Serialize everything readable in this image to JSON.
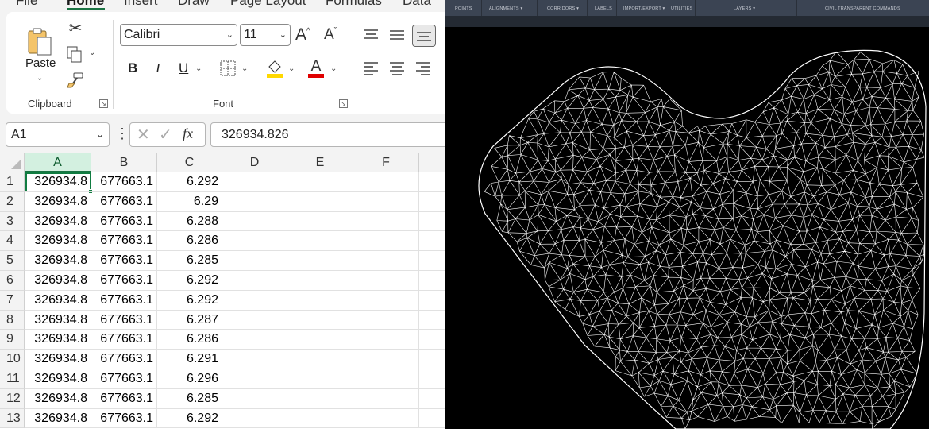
{
  "excel": {
    "tabs": [
      "File",
      "Home",
      "Insert",
      "Draw",
      "Page Layout",
      "Formulas",
      "Data"
    ],
    "active_tab": "Home",
    "clipboard": {
      "paste_label": "Paste",
      "group_label": "Clipboard"
    },
    "font": {
      "family": "Calibri",
      "size": "11",
      "group_label": "Font",
      "fill_color": "#ffd800",
      "font_color": "#e00000",
      "bold_label": "B",
      "italic_label": "I",
      "underline_label": "U",
      "grow_label": "A",
      "shrink_label": "A",
      "fontcolor_letter": "A"
    },
    "name_box": "A1",
    "fx_label": "fx",
    "formula_value": "326934.826",
    "columns": [
      "A",
      "B",
      "C",
      "D",
      "E",
      "F"
    ],
    "rows": [
      {
        "n": "1",
        "a": "326934.8",
        "b": "677663.1",
        "c": "6.292"
      },
      {
        "n": "2",
        "a": "326934.8",
        "b": "677663.1",
        "c": "6.29"
      },
      {
        "n": "3",
        "a": "326934.8",
        "b": "677663.1",
        "c": "6.288"
      },
      {
        "n": "4",
        "a": "326934.8",
        "b": "677663.1",
        "c": "6.286"
      },
      {
        "n": "5",
        "a": "326934.8",
        "b": "677663.1",
        "c": "6.285"
      },
      {
        "n": "6",
        "a": "326934.8",
        "b": "677663.1",
        "c": "6.292"
      },
      {
        "n": "7",
        "a": "326934.8",
        "b": "677663.1",
        "c": "6.292"
      },
      {
        "n": "8",
        "a": "326934.8",
        "b": "677663.1",
        "c": "6.287"
      },
      {
        "n": "9",
        "a": "326934.8",
        "b": "677663.1",
        "c": "6.286"
      },
      {
        "n": "10",
        "a": "326934.8",
        "b": "677663.1",
        "c": "6.291"
      },
      {
        "n": "11",
        "a": "326934.8",
        "b": "677663.1",
        "c": "6.296"
      },
      {
        "n": "12",
        "a": "326934.8",
        "b": "677663.1",
        "c": "6.285"
      },
      {
        "n": "13",
        "a": "326934.8",
        "b": "677663.1",
        "c": "6.292"
      }
    ],
    "accent": "#107c41"
  },
  "cad": {
    "ribbon_labels": [
      "POINTS",
      "ALIGNMENTS ▾",
      "CORRIDORS ▾",
      "LABELS",
      "IMPORT/EXPORT ▾",
      "UTILITIES",
      "LAYERS ▾",
      "CIVIL TRANSPARENT COMMANDS"
    ],
    "background": "#000000",
    "mesh_color": "#ffffff"
  }
}
